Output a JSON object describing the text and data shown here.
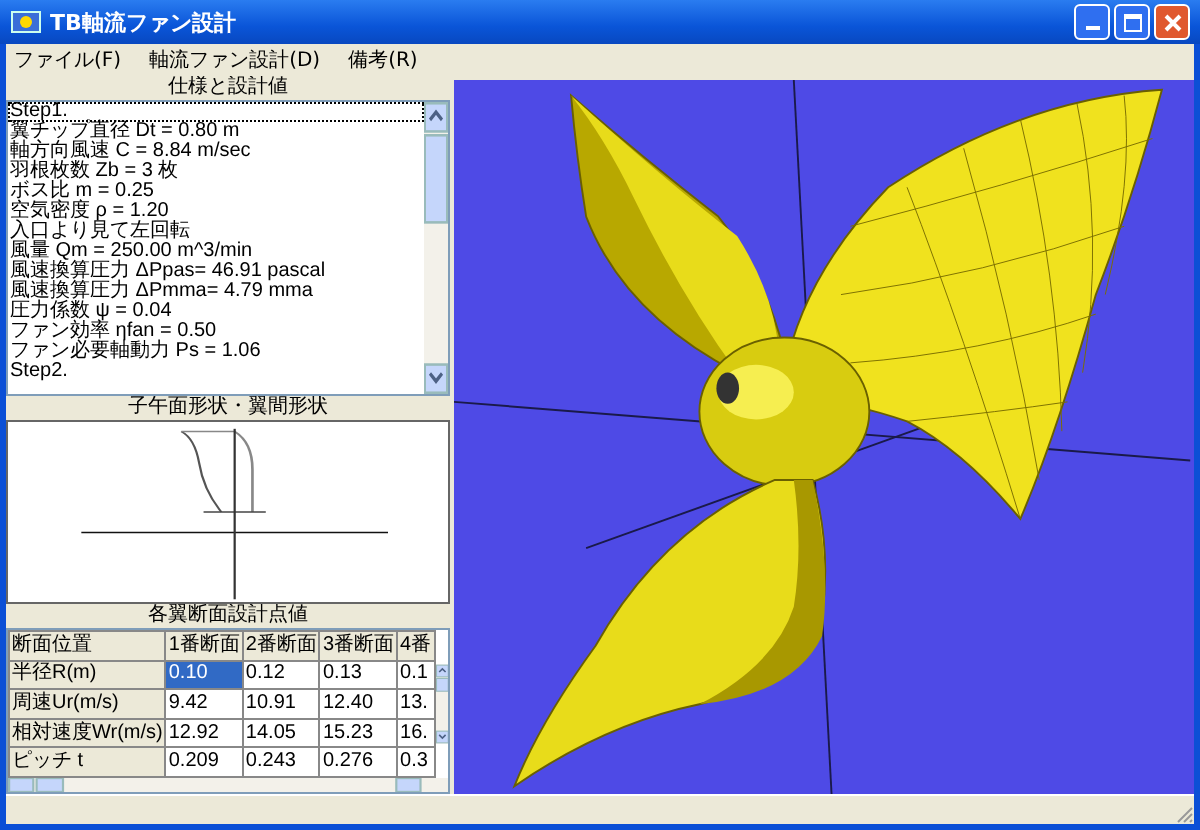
{
  "window": {
    "title": "TB軸流ファン設計"
  },
  "menu": [
    {
      "label": "ファイル(F)"
    },
    {
      "label": "軸流ファン設計(D)"
    },
    {
      "label": "備考(R)"
    }
  ],
  "spec_panel": {
    "title": "仕様と設計値",
    "lines": [
      {
        "text": "Step1.",
        "selected": true
      },
      {
        "text": "翼チップ直径 Dt = 0.80 m",
        "selected": false
      },
      {
        "text": "軸方向風速 C = 8.84 m/sec",
        "selected": false
      },
      {
        "text": "羽根枚数 Zb = 3 枚",
        "selected": false
      },
      {
        "text": "ボス比 m = 0.25",
        "selected": false
      },
      {
        "text": "空気密度 ρ = 1.20",
        "selected": false
      },
      {
        "text": "入口より見て左回転",
        "selected": false
      },
      {
        "text": "風量 Qm = 250.00 m^3/min",
        "selected": false
      },
      {
        "text": "風速換算圧力 ΔPpas= 46.91 pascal",
        "selected": false
      },
      {
        "text": "風速換算圧力 ΔPmma= 4.79 mma",
        "selected": false
      },
      {
        "text": "圧力係数 ψ = 0.04",
        "selected": false
      },
      {
        "text": "ファン効率 ηfan = 0.50",
        "selected": false
      },
      {
        "text": "ファン必要軸動力 Ps = 1.06",
        "selected": false
      },
      {
        "text": "Step2.",
        "selected": false
      }
    ]
  },
  "shape_panel": {
    "title": "子午面形状・翼間形状"
  },
  "section_panel": {
    "title": "各翼断面設計点値",
    "columns": [
      "断面位置",
      "1番断面",
      "2番断面",
      "3番断面",
      "4番"
    ],
    "rows": [
      {
        "cells": [
          {
            "text": "半径R(m)",
            "selected": false
          },
          {
            "text": "0.10",
            "selected": true
          },
          {
            "text": "0.12",
            "selected": false
          },
          {
            "text": "0.13",
            "selected": false
          },
          {
            "text": "0.1",
            "selected": false
          }
        ]
      },
      {
        "cells": [
          {
            "text": "周速Ur(m/s)",
            "selected": false
          },
          {
            "text": "9.42",
            "selected": false
          },
          {
            "text": "10.91",
            "selected": false
          },
          {
            "text": "12.40",
            "selected": false
          },
          {
            "text": "13.",
            "selected": false
          }
        ]
      },
      {
        "cells": [
          {
            "text": "相対速度Wr(m/s)",
            "selected": false
          },
          {
            "text": "12.92",
            "selected": false
          },
          {
            "text": "14.05",
            "selected": false
          },
          {
            "text": "15.23",
            "selected": false
          },
          {
            "text": "16.",
            "selected": false
          }
        ]
      },
      {
        "cells": [
          {
            "text": "ピッチ t",
            "selected": false
          },
          {
            "text": "0.209",
            "selected": false
          },
          {
            "text": "0.243",
            "selected": false
          },
          {
            "text": "0.276",
            "selected": false
          },
          {
            "text": "0.3",
            "selected": false
          }
        ]
      }
    ]
  }
}
